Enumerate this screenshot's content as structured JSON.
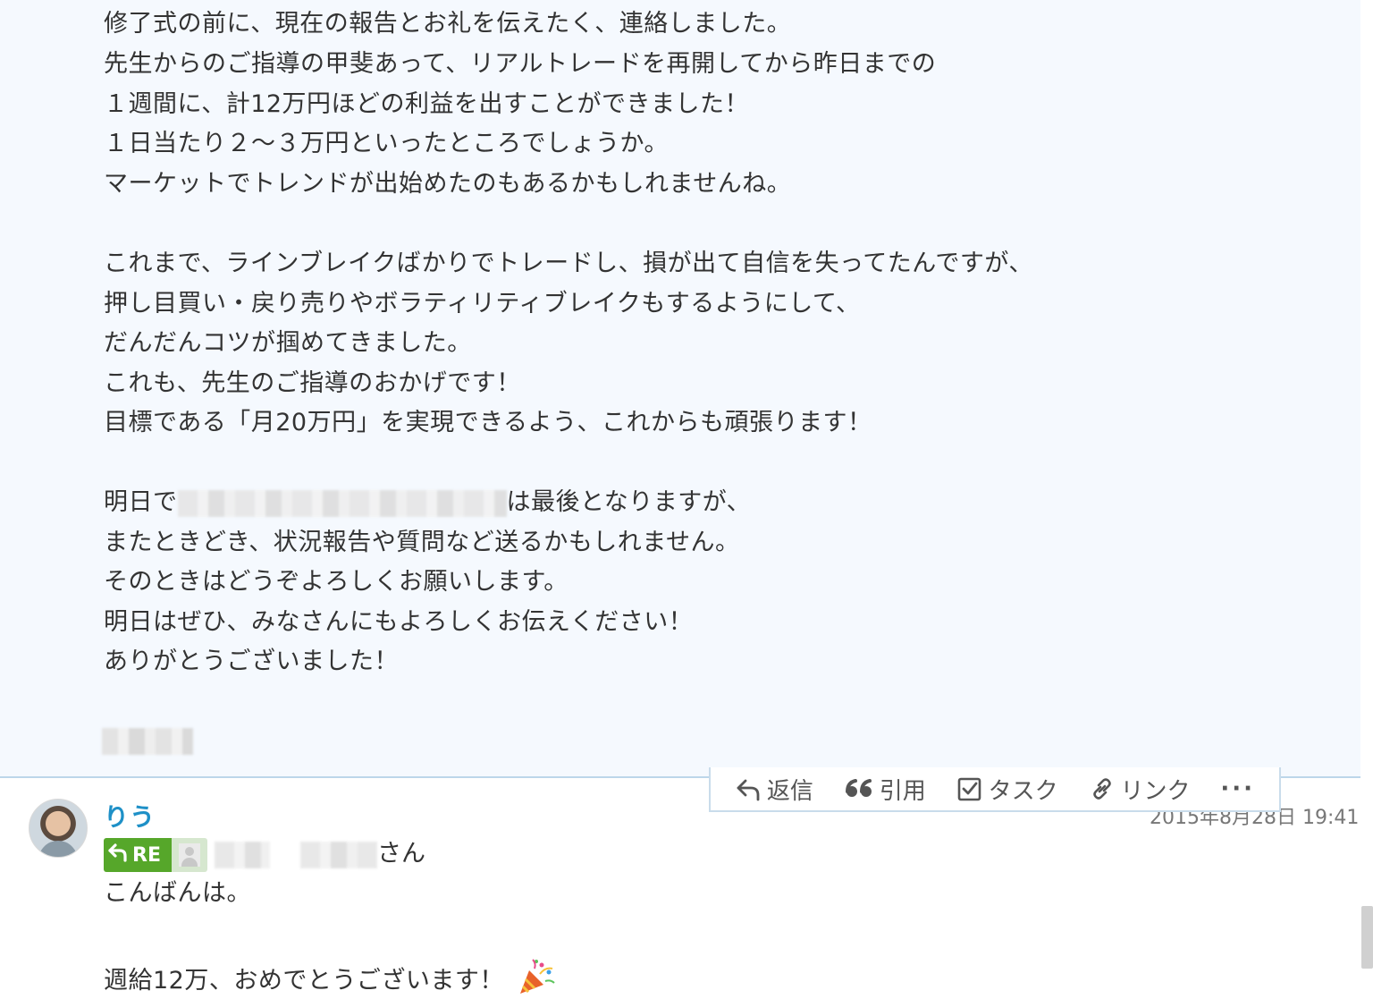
{
  "message": {
    "lines": [
      "修了式の前に、現在の報告とお礼を伝えたく、連絡しました。",
      "先生からのご指導の甲斐あって、リアルトレードを再開してから昨日までの",
      "１週間に、計12万円ほどの利益を出すことができました！",
      "１日当たり２～３万円といったところでしょうか。",
      "マーケットでトレンドが出始めたのもあるかもしれませんね。",
      "",
      "これまで、ラインブレイクばかりでトレードし、損が出て自信を失ってたんですが、",
      "押し目買い・戻り売りやボラティリティブレイクもするようにして、",
      "だんだんコツが掴めてきました。",
      "これも、先生のご指導のおかげです！",
      "目標である「月20万円」を実現できるよう、これからも頑張ります！",
      "",
      "明日で",
      "またときどき、状況報告や質問など送るかもしれません。",
      "そのときはどうぞよろしくお願いします。",
      "明日はぜひ、みなさんにもよろしくお伝えください！",
      "ありがとうございました！"
    ],
    "blurred_line_suffix": "は最後となりますが、"
  },
  "toolbar": {
    "reply_label": "返信",
    "quote_label": "引用",
    "task_label": "タスク",
    "link_label": "リンク",
    "more_label": "···"
  },
  "reply": {
    "author": "りう",
    "timestamp": "2015年8月28日 19:41",
    "re_label": "RE",
    "addressee_suffix": "さん",
    "lines": [
      "こんばんは。",
      "",
      "週給12万、おめでとうございます！"
    ]
  },
  "colors": {
    "selected_bg": "#f5f9fe",
    "author_blue": "#1e90c7",
    "re_green": "#56a72a"
  }
}
